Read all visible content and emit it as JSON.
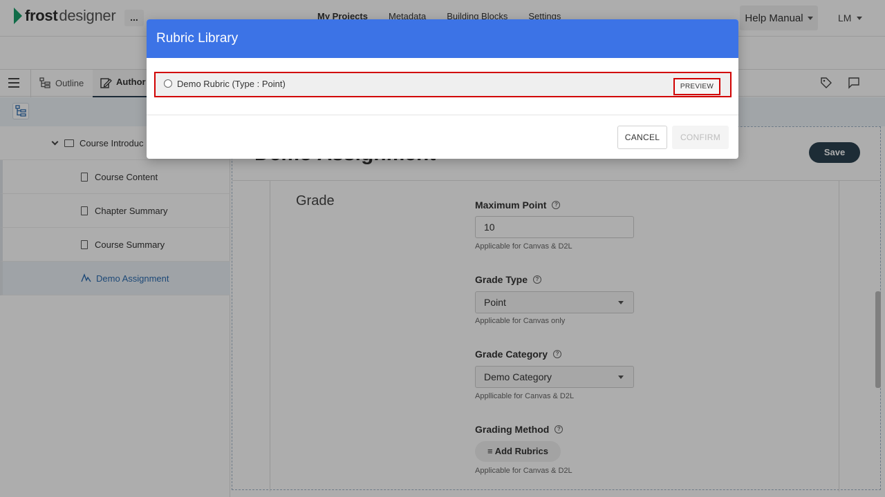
{
  "app": {
    "logo_bold": "frost",
    "logo_light": "designer",
    "more_label": "...",
    "nav": [
      "My Projects",
      "Metadata",
      "Building Blocks",
      "Settings"
    ],
    "help_label": "Help Manual",
    "user_initials": "LM"
  },
  "toolbar": {
    "outline_label": "Outline",
    "author_label": "Author"
  },
  "sidebar": {
    "parent_label": "Course Introduc",
    "items": [
      {
        "label": "Course Content",
        "icon": "document-icon"
      },
      {
        "label": "Chapter Summary",
        "icon": "document-icon"
      },
      {
        "label": "Course Summary",
        "icon": "document-icon"
      },
      {
        "label": "Demo Assignment",
        "icon": "assignment-icon",
        "active": true
      }
    ]
  },
  "content": {
    "title": "Demo Assignment",
    "save_label": "Save",
    "section_heading": "Grade",
    "fields": {
      "max_point": {
        "label": "Maximum Point",
        "value": "10",
        "note": "Applicable for Canvas & D2L"
      },
      "grade_type": {
        "label": "Grade Type",
        "value": "Point",
        "note": "Applicable for Canvas only"
      },
      "grade_category": {
        "label": "Grade Category",
        "value": "Demo Category",
        "note": "Appllicable for Canvas & D2L"
      },
      "grading_method": {
        "label": "Grading Method",
        "button": "Add Rubrics",
        "note": "Applicable for Canvas & D2L"
      }
    }
  },
  "modal": {
    "title": "Rubric Library",
    "rubric_label": "Demo Rubric (Type : Point)",
    "preview_label": "PREVIEW",
    "cancel_label": "CANCEL",
    "confirm_label": "CONFIRM"
  },
  "colors": {
    "modal_header": "#3c73e6",
    "highlight": "#d10000",
    "brand_green": "#19a06a",
    "save_button": "#2b4250"
  }
}
